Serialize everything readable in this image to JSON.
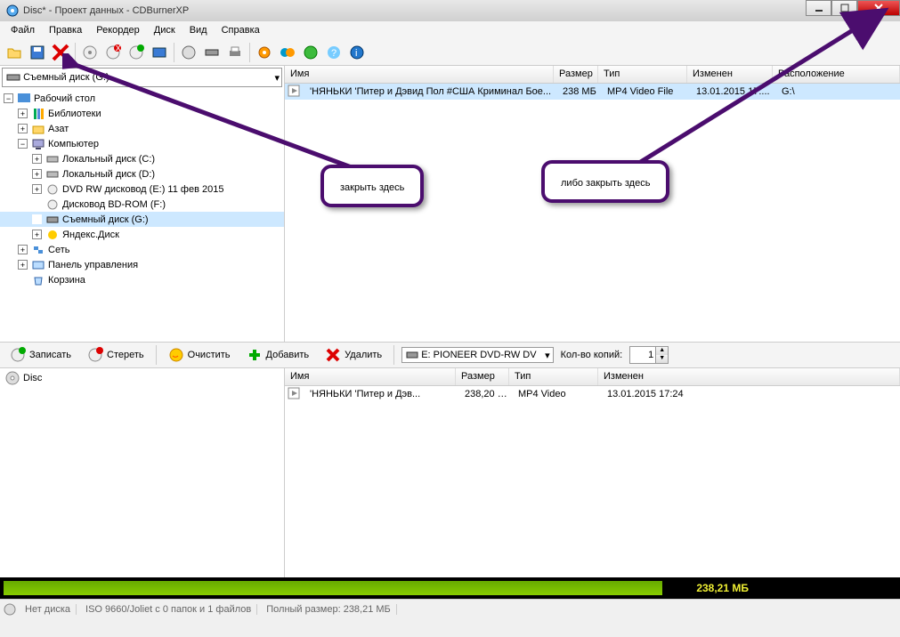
{
  "window": {
    "title": "Disc* - Проект данных - CDBurnerXP"
  },
  "menu": {
    "file": "Файл",
    "edit": "Правка",
    "recorder": "Рекордер",
    "disc": "Диск",
    "view": "Вид",
    "help": "Справка"
  },
  "drivecombo": "Съемный диск (G:)",
  "tree": {
    "desktop": "Рабочий стол",
    "libraries": "Библиотеки",
    "user": "Азат",
    "computer": "Компьютер",
    "localC": "Локальный диск (C:)",
    "localD": "Локальный диск (D:)",
    "dvdrw": "DVD RW дисковод (E:) 11 фев 2015",
    "bdrom": "Дисковод BD-ROM (F:)",
    "removable": "Съемный диск (G:)",
    "yadisk": "Яндекс.Диск",
    "network": "Сеть",
    "controlpanel": "Панель управления",
    "recycle": "Корзина"
  },
  "topcols": {
    "name": "Имя",
    "size": "Размер",
    "type": "Тип",
    "modified": "Изменен",
    "location": "Расположение"
  },
  "toprow": {
    "name": "'НЯНЬКИ 'Питер и Дэвид Пол #США Криминал Бое...",
    "size": "238 МБ",
    "type": "MP4 Video File",
    "modified": "13.01.2015 17:...",
    "location": "G:\\"
  },
  "midbar": {
    "burn": "Записать",
    "erase": "Стереть",
    "clear": "Очистить",
    "add": "Добавить",
    "delete": "Удалить",
    "drive": "E: PIONEER DVD-RW  DV",
    "copies_label": "Кол-во копий:",
    "copies_value": "1"
  },
  "discroot": "Disc",
  "lowcols": {
    "name": "Имя",
    "size": "Размер",
    "type": "Тип",
    "modified": "Изменен"
  },
  "lowrow": {
    "name": "'НЯНЬКИ 'Питер и Дэв...",
    "size": "238,20 МБ",
    "type": "MP4 Video",
    "modified": "13.01.2015 17:24"
  },
  "progress": {
    "size": "238,21 МБ"
  },
  "status": {
    "nodisc": "Нет диска",
    "fs": "ISO 9660/Joliet с 0 папок и 1 файлов",
    "total": "Полный размер: 238,21 МБ"
  },
  "callouts": {
    "close_here": "закрыть здесь",
    "or_close_here": "либо закрыть здесь"
  }
}
